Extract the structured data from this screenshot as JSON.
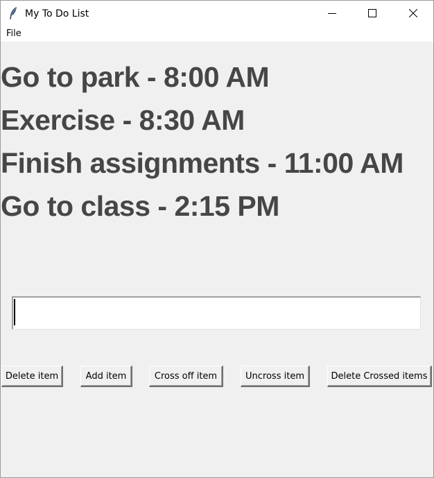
{
  "window": {
    "title": "My To Do List",
    "app_icon": "feather-icon",
    "controls": [
      "minimize-icon",
      "maximize-icon",
      "close-icon"
    ]
  },
  "menubar": {
    "items": [
      "File"
    ]
  },
  "todo_items": [
    "Go to park - 8:00 AM",
    "Exercise - 8:30 AM",
    "Finish assignments - 11:00 AM",
    "Go to class - 2:15 PM"
  ],
  "entry": {
    "value": ""
  },
  "buttons": {
    "delete_item": "Delete item",
    "add_item": "Add item",
    "cross_off_item": "Cross off item",
    "uncross_item": "Uncross item",
    "delete_crossed_items": "Delete Crossed items"
  },
  "colors": {
    "item_text": "#464646",
    "background": "#f0f0f0"
  }
}
